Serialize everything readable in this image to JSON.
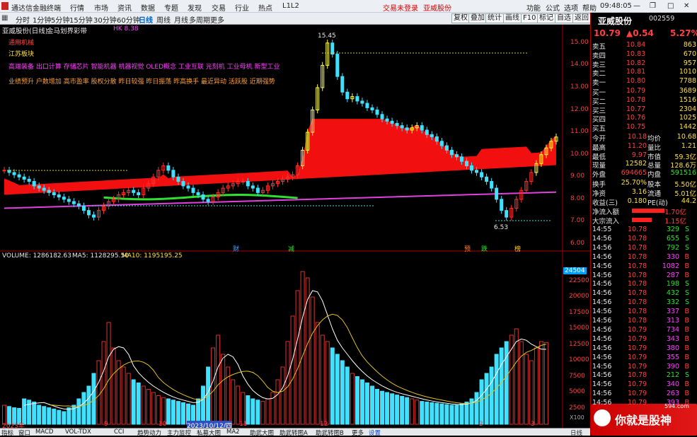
{
  "app": {
    "title": "通达信金融终端",
    "menus": [
      "行情",
      "市场",
      "资讯",
      "数据",
      "专题",
      "发现",
      "交易",
      "行业",
      "热点",
      "L1L2"
    ],
    "notice": "交易未登录",
    "notice_stock": "亚威股份",
    "win_right": [
      "功能",
      "公式",
      "选项",
      "帮助"
    ],
    "clock": "09:48:05"
  },
  "toolbar": {
    "periods": [
      "分时",
      "1分钟",
      "5分钟",
      "15分钟",
      "30分钟",
      "60分钟",
      "日线",
      "周线",
      "月线",
      "多周期",
      "更多"
    ],
    "active": "日线",
    "right_buttons": [
      "复权",
      "叠加",
      "统计",
      "画线",
      "F10",
      "标记",
      "自选",
      "返回"
    ]
  },
  "chart": {
    "stock_label": "亚威股份(日线)",
    "indicator": "金马划界彩带",
    "hk_label": "HK 8.38",
    "tags": [
      "通用机械",
      "江苏板块"
    ],
    "concepts": "高端装备 出口计算 存储芯片 智能机器 机器视觉 OLED概念 工业互联 光刻机 工业母机 新型工业",
    "reasons": "业绩预升 户数增加 高市盈率 股权分散 昨日较强 昨日振荡 昨高换手 最近异动 活跃股 近期强势",
    "high_label": "15.45",
    "low_label": "6.53",
    "price_ticks": [
      "15.00",
      "14.00",
      "13.00",
      "12.00",
      "11.00",
      "10.00",
      "9.00",
      "8.00",
      "7.00",
      "6.00"
    ],
    "markers": [
      "财",
      "减",
      "预",
      "跌",
      "榜"
    ],
    "vol_label": "VOLUME: 1286182.63",
    "ma5_label": "MA5: 1128295.50",
    "ma10_label": "MA10: 1195195.25",
    "vol_ticks": [
      "22500",
      "20000",
      "17500",
      "15000",
      "12500",
      "10000",
      "7500",
      "5000",
      "2500"
    ],
    "vol_cursor": "24504",
    "vol_unit": "X100",
    "date_labels": [
      "2023年",
      "9",
      "10",
      "2023/10/12/四",
      "11",
      "12",
      "2",
      "3"
    ],
    "period_tag": "日线"
  },
  "chart_data": {
    "type": "candlestick",
    "y_range": [
      6,
      15.5
    ],
    "volume_range": [
      0,
      25000
    ],
    "closes": [
      9.3,
      9.2,
      9.1,
      9.0,
      8.9,
      8.8,
      8.6,
      8.5,
      8.4,
      8.3,
      8.2,
      8.1,
      8.0,
      7.9,
      7.8,
      7.7,
      7.5,
      7.3,
      7.2,
      7.5,
      7.7,
      7.9,
      8.0,
      8.2,
      8.3,
      8.4,
      8.3,
      8.2,
      8.5,
      8.7,
      9.0,
      9.3,
      9.5,
      9.3,
      9.0,
      8.8,
      8.6,
      8.5,
      8.3,
      8.2,
      8.0,
      7.9,
      8.1,
      8.3,
      8.5,
      8.6,
      8.7,
      8.8,
      8.8,
      8.6,
      8.5,
      8.3,
      8.4,
      8.6,
      8.7,
      8.8,
      8.9,
      9.0,
      9.1,
      9.5,
      10.2,
      11.0,
      12.0,
      13.0,
      14.0,
      15.0,
      14.5,
      13.5,
      12.8,
      12.5,
      12.6,
      12.4,
      12.3,
      12.1,
      12.0,
      11.8,
      11.6,
      11.5,
      11.4,
      11.3,
      11.2,
      11.1,
      11.2,
      11.3,
      11.1,
      10.9,
      10.8,
      10.6,
      10.4,
      10.2,
      10.0,
      9.9,
      9.7,
      9.5,
      9.3,
      9.2,
      9.0,
      8.8,
      8.5,
      8.0,
      7.5,
      7.2,
      7.6,
      8.0,
      8.4,
      8.8,
      9.2,
      9.6,
      10.0,
      10.3,
      10.6,
      10.79
    ],
    "volumes": [
      3000,
      2800,
      2600,
      2500,
      4000,
      3800,
      3500,
      3000,
      2800,
      2600,
      2400,
      2200,
      2000,
      2600,
      3000,
      4000,
      5000,
      6000,
      8000,
      10000,
      13000,
      16000,
      12000,
      10000,
      9000,
      8000,
      7000,
      6500,
      6000,
      5500,
      5000,
      4500,
      4200,
      4000,
      3800,
      3600,
      3400,
      3200,
      3000,
      4000,
      6000,
      9000,
      12000,
      14000,
      11000,
      9000,
      7000,
      6000,
      5000,
      4500,
      4000,
      3800,
      3600,
      4000,
      5000,
      7000,
      9000,
      13000,
      17000,
      21000,
      24000,
      23000,
      20000,
      16000,
      14000,
      13000,
      12000,
      11000,
      10000,
      9000,
      8000,
      7500,
      7000,
      6500,
      6000,
      5500,
      5200,
      5000,
      4800,
      4600,
      4400,
      4200,
      4000,
      3800,
      3600,
      3500,
      3400,
      3300,
      3200,
      3100,
      3000,
      3000,
      3200,
      3500,
      4000,
      5000,
      7000,
      8000,
      9000,
      11000,
      12000,
      13000,
      14000,
      15000,
      13000,
      11000,
      10000,
      12000,
      13000,
      12862
    ]
  },
  "quote": {
    "name": "亚威股份",
    "code": "002559",
    "price": "10.79",
    "change": "▲0.54",
    "pct": "5.27%",
    "asks": [
      [
        "卖五",
        "10.84",
        "863"
      ],
      [
        "卖四",
        "10.83",
        "670"
      ],
      [
        "卖三",
        "10.82",
        "957"
      ],
      [
        "卖二",
        "10.81",
        "1010"
      ],
      [
        "卖一",
        "10.80",
        "7788"
      ]
    ],
    "bids": [
      [
        "买一",
        "10.79",
        "3689"
      ],
      [
        "买二",
        "10.78",
        "1516"
      ],
      [
        "买三",
        "10.77",
        "2304"
      ],
      [
        "买四",
        "10.76",
        "1025"
      ],
      [
        "买五",
        "10.75",
        "1442"
      ]
    ],
    "stats": [
      [
        "今开",
        "10.18",
        "均价",
        "10.68"
      ],
      [
        "最高",
        "11.20",
        "量比",
        "1.21"
      ],
      [
        "最低",
        "9.97",
        "市值",
        "59.3亿"
      ],
      [
        "现量",
        "12582",
        "总量",
        "128.6万"
      ],
      [
        "外盘",
        "694665",
        "内盘",
        "591516"
      ]
    ],
    "stats2": [
      [
        "换手",
        "25.70%",
        "股本",
        "5.50亿"
      ],
      [
        "净资",
        "3.16",
        "流通",
        "5.01亿"
      ],
      [
        "收益(三)",
        "0.180",
        "PE(动)",
        "44.2"
      ]
    ],
    "flows": [
      [
        "净流入额",
        "1.70亿"
      ],
      [
        "大宗流入",
        "1.15亿"
      ]
    ],
    "ticks": [
      [
        "14:55",
        "10.78",
        "329",
        "S"
      ],
      [
        "14:56",
        "10.78",
        "655",
        "S"
      ],
      [
        "14:56",
        "10.78",
        "792",
        "S"
      ],
      [
        "14:56",
        "10.78",
        "330",
        "B"
      ],
      [
        "14:56",
        "10.78",
        "1082",
        "B"
      ],
      [
        "14:56",
        "10.78",
        "287",
        "B"
      ],
      [
        "14:56",
        "10.78",
        "198",
        "S"
      ],
      [
        "14:56",
        "10.78",
        "432",
        "S"
      ],
      [
        "14:56",
        "10.78",
        "332",
        "S"
      ],
      [
        "14:56",
        "10.78",
        "337",
        "B"
      ],
      [
        "14:56",
        "10.78",
        "313",
        "B"
      ],
      [
        "14:56",
        "10.79",
        "734",
        "B"
      ],
      [
        "14:56",
        "10.79",
        "343",
        "B"
      ],
      [
        "14:56",
        "10.79",
        "380",
        "B"
      ],
      [
        "14:56",
        "10.79",
        "355",
        "B"
      ],
      [
        "14:56",
        "10.79",
        "390",
        "B"
      ],
      [
        "14:56",
        "10.78",
        "212",
        "S"
      ],
      [
        "14:56",
        "10.79",
        "340",
        "B"
      ],
      [
        "14:56",
        "10.79",
        "263",
        "B"
      ],
      [
        "14:56",
        "10.79",
        "393",
        "B"
      ]
    ]
  },
  "bottom": {
    "tabs": [
      "指标",
      "窗口",
      "MACD",
      "VOL-TDX",
      "CCI",
      "趋势动力",
      "主力监控",
      "私募大图",
      "MA2",
      "助武大图",
      "助武转图A",
      "助武转图B",
      "更多",
      "设置"
    ]
  },
  "watermark": "你就是股神",
  "watermark_site": "594.com"
}
